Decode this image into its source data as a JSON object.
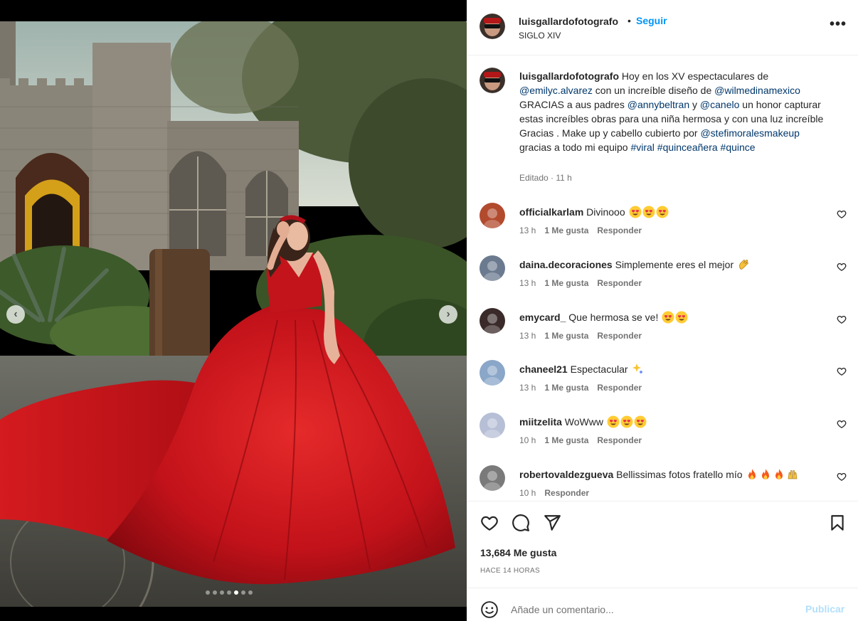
{
  "post": {
    "username": "luisgallardofotografo",
    "separator": "•",
    "follow_label": "Seguir",
    "location": "SIGLO XIV",
    "more_label": "•••"
  },
  "caption": {
    "username": "luisgallardofotografo",
    "segments": [
      {
        "t": " Hoy en los XV espectaculares de ",
        "m": false
      },
      {
        "t": "@emilyc.alvarez",
        "m": true
      },
      {
        "t": " con un increíble diseño de ",
        "m": false
      },
      {
        "t": "@wilmedinamexico",
        "m": true
      },
      {
        "t": " GRACIAS a aus padres ",
        "m": false
      },
      {
        "t": "@annybeltran",
        "m": true
      },
      {
        "t": " y ",
        "m": false
      },
      {
        "t": "@canelo",
        "m": true
      },
      {
        "t": " un honor capturar estas increíbles obras para una niña hermosa y con una luz increíble Gracias . Make up y cabello cubierto por ",
        "m": false
      },
      {
        "t": "@stefimoralesmakeup",
        "m": true
      },
      {
        "t": " gracias a todo mi equipo ",
        "m": false
      },
      {
        "t": "#viral",
        "m": true
      },
      {
        "t": " ",
        "m": false
      },
      {
        "t": "#quinceañera",
        "m": true
      },
      {
        "t": " ",
        "m": false
      },
      {
        "t": "#quince",
        "m": true
      }
    ],
    "meta": "Editado · 11 h"
  },
  "comments": [
    {
      "user": "officialkarlam",
      "text": "Divinooo",
      "emoji": [
        "heart-eyes",
        "heart-eyes",
        "heart-eyes"
      ],
      "time": "13 h",
      "likes": "1 Me gusta",
      "reply": "Responder",
      "avatar_color": "#b24a2e"
    },
    {
      "user": "daina.decoraciones",
      "text": "Simplemente eres el mejor",
      "emoji": [
        "clap"
      ],
      "time": "13 h",
      "likes": "1 Me gusta",
      "reply": "Responder",
      "avatar_color": "#6b7a8f"
    },
    {
      "user": "emycard_",
      "text": "Que hermosa se ve!",
      "emoji": [
        "heart-eyes",
        "heart-eyes"
      ],
      "time": "13 h",
      "likes": "1 Me gusta",
      "reply": "Responder",
      "avatar_color": "#3a2a2a"
    },
    {
      "user": "chaneel21",
      "text": "Espectacular",
      "emoji": [
        "sparkles"
      ],
      "time": "13 h",
      "likes": "1 Me gusta",
      "reply": "Responder",
      "avatar_color": "#8aa6c8"
    },
    {
      "user": "miitzelita",
      "text": "WoWww",
      "emoji": [
        "heart-eyes",
        "heart-eyes",
        "heart-eyes"
      ],
      "time": "10 h",
      "likes": "1 Me gusta",
      "reply": "Responder",
      "avatar_color": "#b6bfd6"
    },
    {
      "user": "robertovaldezgueva",
      "text": "Bellissimas fotos fratello mío",
      "emoji": [
        "fire",
        "fire",
        "fire",
        "raised-hands"
      ],
      "time": "10 h",
      "likes": "",
      "reply": "Responder",
      "avatar_color": "#7a7a7a"
    }
  ],
  "actions": {
    "likes": "13,684 Me gusta",
    "time": "HACE 14 HORAS"
  },
  "composer": {
    "placeholder": "Añade un comentario...",
    "publish_label": "Publicar"
  },
  "carousel": {
    "slide_count": 7,
    "active_index": 4,
    "prev_label": "‹",
    "next_label": "›"
  },
  "colors": {
    "link": "#0095f6",
    "mention": "#00376b",
    "muted": "#737373",
    "dress": "#c8141c"
  }
}
